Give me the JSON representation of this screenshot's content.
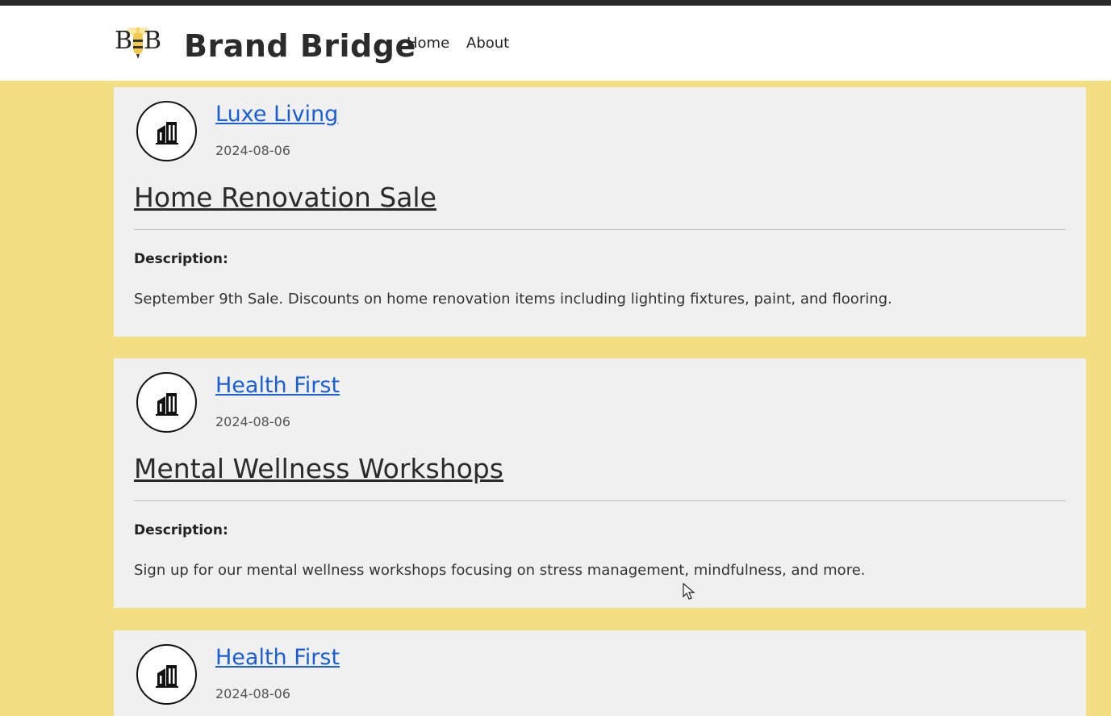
{
  "header": {
    "brand": "Brand Bridge",
    "logo_text": "BB",
    "nav": {
      "home": "Home",
      "about": "About"
    }
  },
  "posts": [
    {
      "company": "Luxe Living",
      "date": "2024-08-06",
      "title": "Home Renovation Sale",
      "description_label": "Description:",
      "description": "September 9th Sale. Discounts on home renovation items including lighting fixtures, paint, and flooring."
    },
    {
      "company": "Health First",
      "date": "2024-08-06",
      "title": "Mental Wellness Workshops",
      "description_label": "Description:",
      "description": "Sign up for our mental wellness workshops focusing on stress management, mindfulness, and more."
    },
    {
      "company": "Health First",
      "date": "2024-08-06"
    }
  ],
  "colors": {
    "background": "#f4de84",
    "card": "#f0f0f0",
    "link": "#1a5fd6",
    "navbar": "#ffffff"
  },
  "icons": {
    "company_avatar": "building-icon",
    "logo": "bee-logo-icon"
  }
}
